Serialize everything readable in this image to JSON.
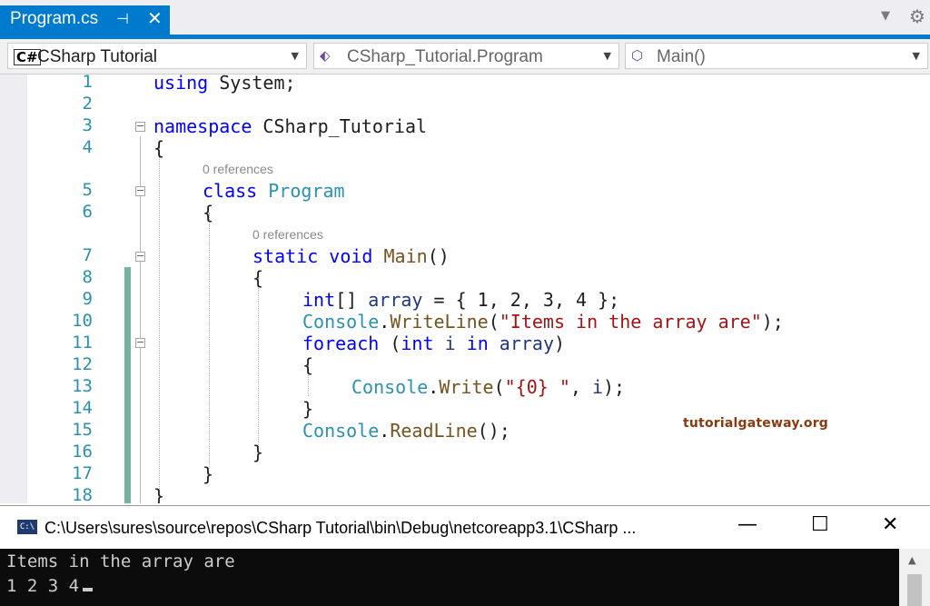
{
  "tab": {
    "title": "Program.cs",
    "pin": "⊣",
    "close": "✕"
  },
  "navbar": {
    "project": "CSharp Tutorial",
    "class": "CSharp_Tutorial.Program",
    "member": "Main()"
  },
  "editor": {
    "line_numbers": [
      "1",
      "2",
      "3",
      "4",
      "5",
      "6",
      "7",
      "8",
      "9",
      "10",
      "11",
      "12",
      "13",
      "14",
      "15",
      "16",
      "17",
      "18"
    ],
    "codelens": [
      "0 references",
      "0 references"
    ],
    "code": {
      "l1": [
        "using",
        " System;"
      ],
      "l3": [
        "namespace",
        " CSharp_Tutorial"
      ],
      "l4": "{",
      "l5": [
        "class",
        " ",
        "Program"
      ],
      "l6": "{",
      "l7": [
        "static",
        " ",
        "void",
        " ",
        "Main",
        "()"
      ],
      "l8": "{",
      "l9": [
        "int",
        "[] ",
        "array",
        " = { 1, 2, 3, 4 };"
      ],
      "l10": [
        "Console",
        ".",
        "WriteLine",
        "(",
        "\"Items in the array are\"",
        ");"
      ],
      "l11": [
        "foreach",
        " (",
        "int",
        " ",
        "i",
        " ",
        "in",
        " ",
        "array",
        ")"
      ],
      "l12": "{",
      "l13": [
        "Console",
        ".",
        "Write",
        "(",
        "\"{0} \"",
        ", ",
        "i",
        ");"
      ],
      "l14": "}",
      "l15": [
        "Console",
        ".",
        "ReadLine",
        "();"
      ],
      "l16": "}",
      "l17": "}",
      "l18": "}"
    },
    "watermark": "tutorialgateway.org"
  },
  "console": {
    "title": "C:\\Users\\sures\\source\\repos\\CSharp Tutorial\\bin\\Debug\\netcoreapp3.1\\CSharp ...",
    "icon": "C:\\",
    "minimize": "—",
    "maximize": "☐",
    "close": "✕",
    "output": [
      "Items in the array are",
      "1 2 3 4"
    ]
  },
  "colors": {
    "accent": "#007acc",
    "line_number": "#2b91af",
    "keyword": "#0000ff",
    "type": "#2b91af",
    "string": "#a31515",
    "change_bar": "#76b3a0",
    "console_bg": "#0c0c0c"
  }
}
